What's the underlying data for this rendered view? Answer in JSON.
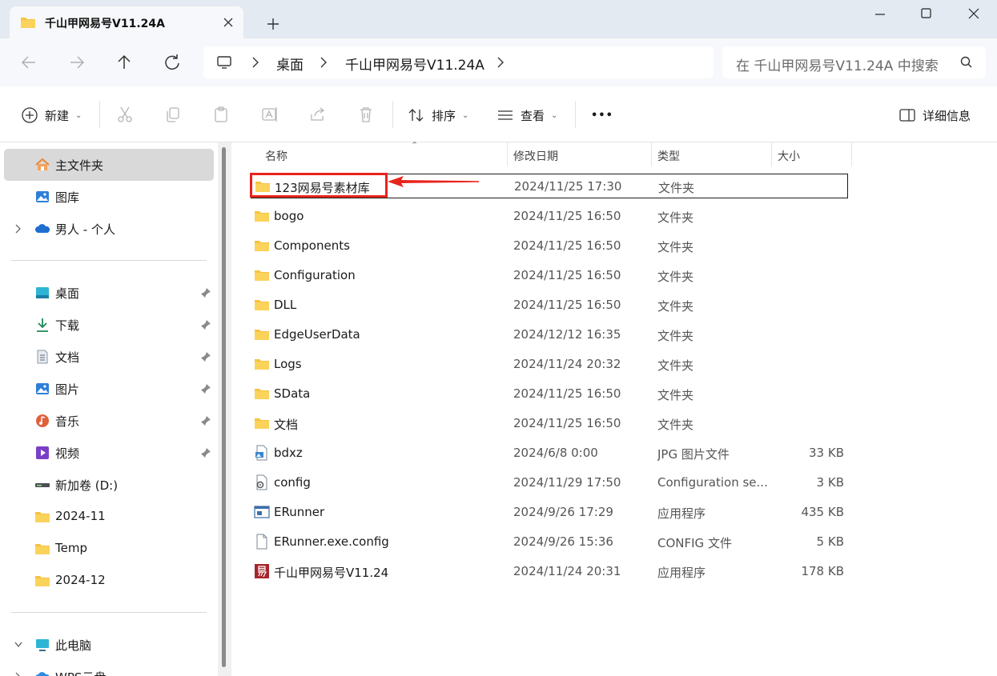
{
  "window": {
    "tab_title": "千山甲网易号V11.24A",
    "colors": {
      "titlebar_bg": "#e4eaf2",
      "annotation": "#e8241c",
      "folder": "#f6c342"
    }
  },
  "address": {
    "crumbs": [
      "桌面",
      "千山甲网易号V11.24A"
    ],
    "search_placeholder": "在 千山甲网易号V11.24A 中搜索"
  },
  "toolbar": {
    "new_label": "新建",
    "sort_label": "排序",
    "view_label": "查看",
    "more_label": "•••",
    "details_label": "详细信息"
  },
  "sidebar": {
    "items": [
      {
        "label": "主文件夹",
        "icon": "home-icon"
      },
      {
        "label": "图库",
        "icon": "gallery-icon"
      },
      {
        "label": "男人 - 个人",
        "icon": "onedrive-icon"
      },
      {
        "label": "桌面",
        "icon": "desktop-icon"
      },
      {
        "label": "下载",
        "icon": "download-icon"
      },
      {
        "label": "文档",
        "icon": "document-icon"
      },
      {
        "label": "图片",
        "icon": "pictures-icon"
      },
      {
        "label": "音乐",
        "icon": "music-icon"
      },
      {
        "label": "视频",
        "icon": "video-icon"
      },
      {
        "label": "新加卷 (D:)",
        "icon": "drive-icon"
      },
      {
        "label": "2024-11",
        "icon": "folder-icon"
      },
      {
        "label": "Temp",
        "icon": "folder-icon"
      },
      {
        "label": "2024-12",
        "icon": "folder-icon"
      },
      {
        "label": "此电脑",
        "icon": "computer-icon"
      },
      {
        "label": "WPS云盘",
        "icon": "cloud-icon"
      }
    ]
  },
  "list": {
    "headers": {
      "name": "名称",
      "date": "修改日期",
      "type": "类型",
      "size": "大小"
    },
    "rows": [
      {
        "name": "123网易号素材库",
        "date": "2024/11/25 17:30",
        "type": "文件夹",
        "size": "",
        "icon": "folder-icon"
      },
      {
        "name": "bogo",
        "date": "2024/11/25 16:50",
        "type": "文件夹",
        "size": "",
        "icon": "folder-icon"
      },
      {
        "name": "Components",
        "date": "2024/11/25 16:50",
        "type": "文件夹",
        "size": "",
        "icon": "folder-icon"
      },
      {
        "name": "Configuration",
        "date": "2024/11/25 16:50",
        "type": "文件夹",
        "size": "",
        "icon": "folder-icon"
      },
      {
        "name": "DLL",
        "date": "2024/11/25 16:50",
        "type": "文件夹",
        "size": "",
        "icon": "folder-icon"
      },
      {
        "name": "EdgeUserData",
        "date": "2024/12/12 16:35",
        "type": "文件夹",
        "size": "",
        "icon": "folder-icon"
      },
      {
        "name": "Logs",
        "date": "2024/11/24 20:32",
        "type": "文件夹",
        "size": "",
        "icon": "folder-icon"
      },
      {
        "name": "SData",
        "date": "2024/11/25 16:50",
        "type": "文件夹",
        "size": "",
        "icon": "folder-icon"
      },
      {
        "name": "文档",
        "date": "2024/11/25 16:50",
        "type": "文件夹",
        "size": "",
        "icon": "folder-icon"
      },
      {
        "name": "bdxz",
        "date": "2024/6/8 0:00",
        "type": "JPG 图片文件",
        "size": "33 KB",
        "icon": "image-file-icon"
      },
      {
        "name": "config",
        "date": "2024/11/29 17:50",
        "type": "Configuration se...",
        "size": "3 KB",
        "icon": "settings-file-icon"
      },
      {
        "name": "ERunner",
        "date": "2024/9/26 17:29",
        "type": "应用程序",
        "size": "435 KB",
        "icon": "app-window-icon"
      },
      {
        "name": "ERunner.exe.config",
        "date": "2024/9/26 15:36",
        "type": "CONFIG 文件",
        "size": "5 KB",
        "icon": "blank-file-icon"
      },
      {
        "name": "千山甲网易号V11.24",
        "date": "2024/11/24 20:31",
        "type": "应用程序",
        "size": "178 KB",
        "icon": "yi-app-icon"
      }
    ]
  }
}
